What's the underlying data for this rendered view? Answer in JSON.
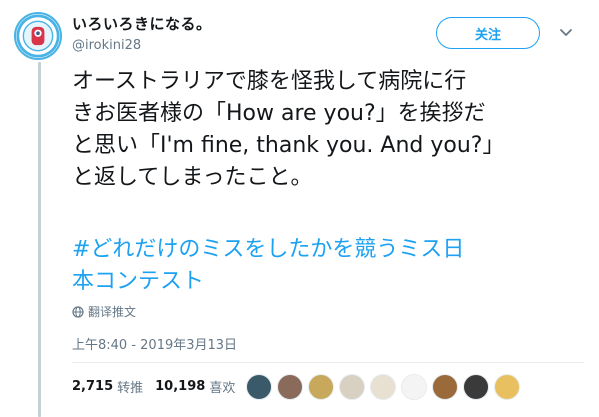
{
  "user": {
    "display_name": "いろいろきになる。",
    "handle": "@irokini28",
    "avatar_icon": "blue-ring-logo-avatar"
  },
  "follow_label": "关注",
  "menu_icon": "chevron-down-icon",
  "tweet": {
    "lines": [
      "オーストラリアで膝を怪我して病院に行",
      "きお医者様の「How are you?」を挨拶だ",
      "と思い「I'm fine, thank you. And you?」",
      "と返してしまったこと。"
    ],
    "hashtag_lines": [
      "#どれだけのミスをしたかを競うミス日",
      "本コンテスト"
    ]
  },
  "translate_label": "翻译推文",
  "timestamp": "上午8:40 - 2019年3月13日",
  "stats": {
    "retweets_count": "2,715",
    "retweets_label": "转推",
    "likes_count": "10,198",
    "likes_label": "喜欢"
  },
  "likers": [
    {
      "name": "liker-avatar-1",
      "color": "#3a5a6a"
    },
    {
      "name": "liker-avatar-2",
      "color": "#8a6a5a"
    },
    {
      "name": "liker-avatar-3",
      "color": "#c8a85a"
    },
    {
      "name": "liker-avatar-4",
      "color": "#d8d0c0"
    },
    {
      "name": "liker-avatar-5",
      "color": "#e8e0d0"
    },
    {
      "name": "liker-avatar-6",
      "color": "#f4f4f4"
    },
    {
      "name": "liker-avatar-7",
      "color": "#9a6a3a"
    },
    {
      "name": "liker-avatar-8",
      "color": "#3a3a3a"
    },
    {
      "name": "liker-avatar-9",
      "color": "#e8c060"
    }
  ],
  "colors": {
    "accent": "#1da1f2",
    "muted": "#657786"
  }
}
